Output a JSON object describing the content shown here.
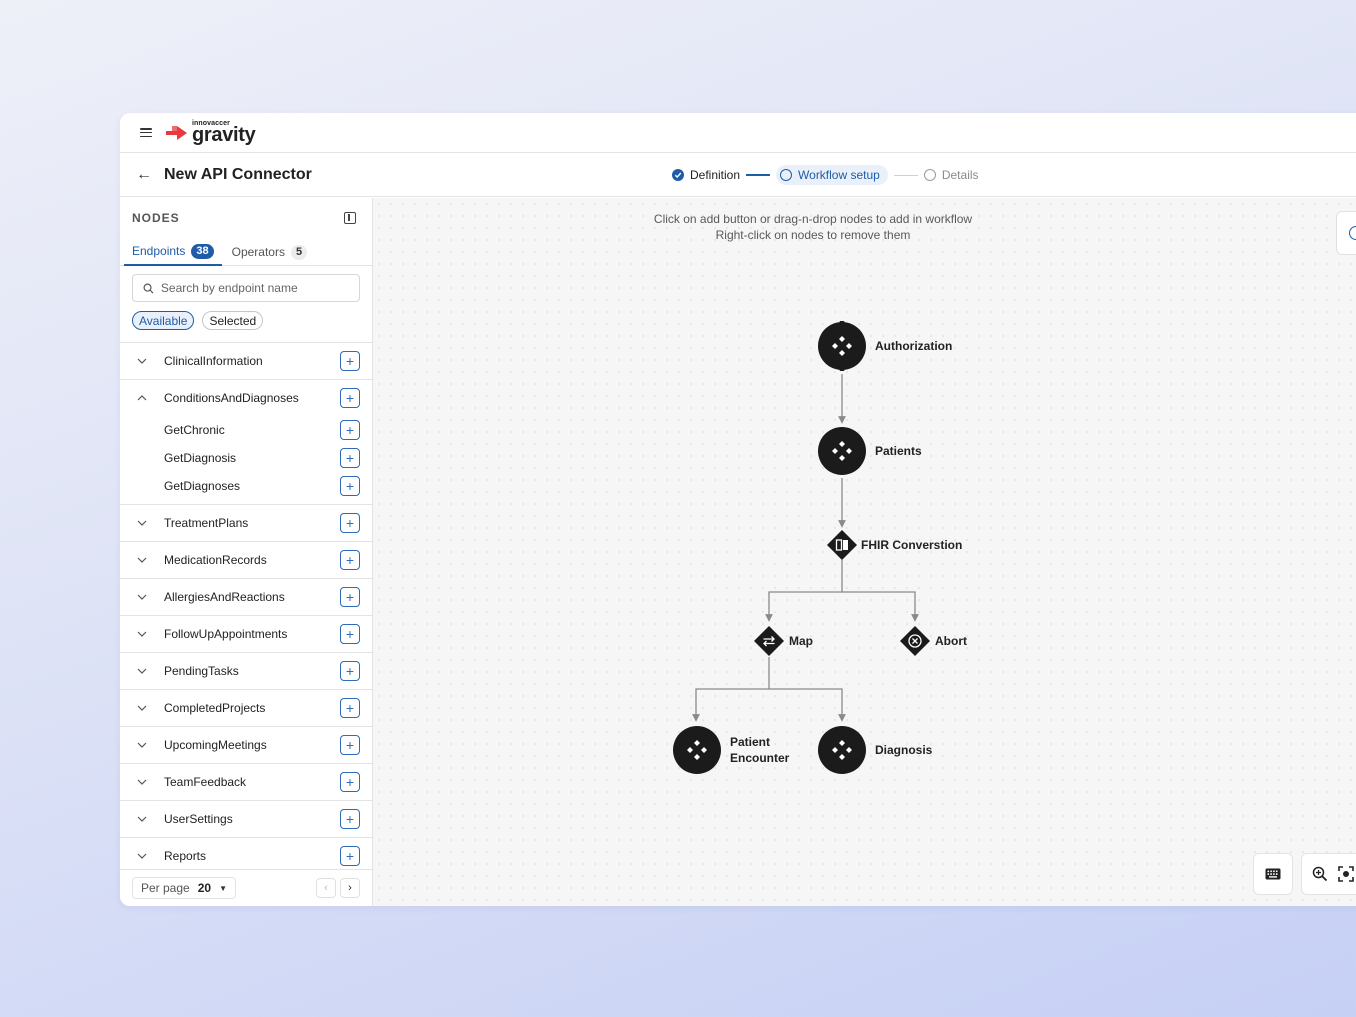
{
  "app": {
    "brand_small": "innovaccer",
    "brand_name": "gravity"
  },
  "header": {
    "title": "New API Connector",
    "steps": [
      {
        "label": "Definition",
        "state": "done"
      },
      {
        "label": "Workflow setup",
        "state": "active"
      },
      {
        "label": "Details",
        "state": "todo"
      }
    ]
  },
  "sidebar": {
    "title": "NODES",
    "tabs": [
      {
        "label": "Endpoints",
        "count": "38"
      },
      {
        "label": "Operators",
        "count": "5"
      }
    ],
    "search_placeholder": "Search by endpoint name",
    "filters": [
      "Available",
      "Selected"
    ],
    "groups": [
      {
        "name": "ClinicalInformation",
        "expanded": false
      },
      {
        "name": "ConditionsAndDiagnoses",
        "expanded": true,
        "children": [
          "GetChronic",
          "GetDiagnosis",
          "GetDiagnoses"
        ]
      },
      {
        "name": "TreatmentPlans",
        "expanded": false
      },
      {
        "name": "MedicationRecords",
        "expanded": false
      },
      {
        "name": "AllergiesAndReactions",
        "expanded": false
      },
      {
        "name": "FollowUpAppointments",
        "expanded": false
      },
      {
        "name": "PendingTasks",
        "expanded": false
      },
      {
        "name": "CompletedProjects",
        "expanded": false
      },
      {
        "name": "UpcomingMeetings",
        "expanded": false
      },
      {
        "name": "TeamFeedback",
        "expanded": false
      },
      {
        "name": "UserSettings",
        "expanded": false
      },
      {
        "name": "Reports",
        "expanded": false
      }
    ],
    "pager": {
      "per_page_label": "Per page",
      "per_page_value": "20"
    }
  },
  "canvas": {
    "hint_line1": "Click on add button or drag-n-drop nodes to add in workflow",
    "hint_line2": "Right-click on nodes to remove them",
    "nodes": {
      "authorization": "Authorization",
      "patients": "Patients",
      "fhir": "FHIR Converstion",
      "map": "Map",
      "abort": "Abort",
      "patient_encounter_1": "Patient",
      "patient_encounter_2": "Encounter",
      "diagnosis": "Diagnosis"
    }
  },
  "colors": {
    "accent": "#1f5ca8",
    "brand": "#e8393f",
    "node_fill": "#1b1b1b"
  }
}
